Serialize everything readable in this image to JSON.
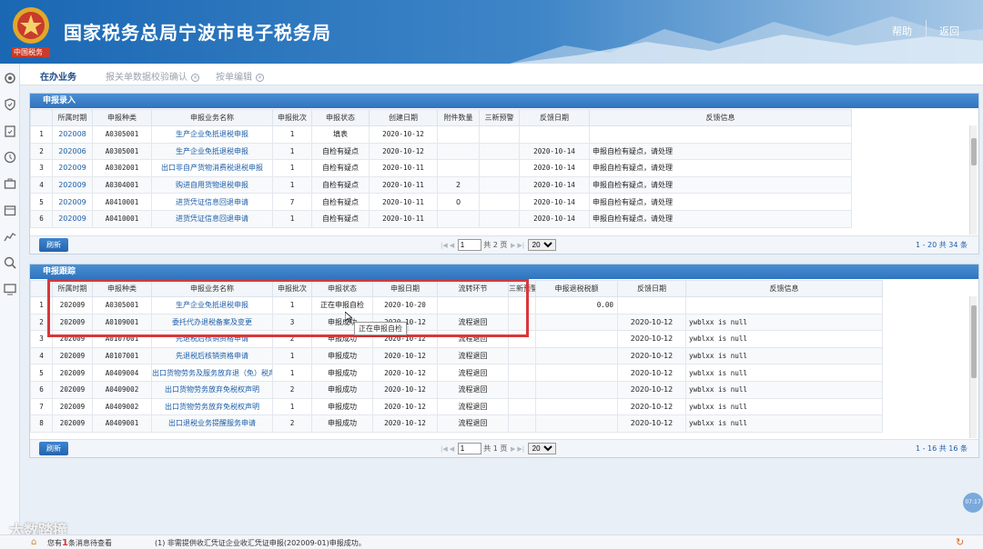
{
  "header": {
    "title": "国家税务总局宁波市电子税务局",
    "emblem_text": "中国税务",
    "help": "帮助",
    "back": "返回"
  },
  "tabs": [
    {
      "label": "在办业务"
    },
    {
      "label": "报关单数据校验确认"
    },
    {
      "label": "按单编辑"
    }
  ],
  "sidebar_icons": [
    "gear-icon",
    "shield-icon",
    "clipboard-check-icon",
    "tag-icon",
    "briefcase-icon",
    "calendar-icon",
    "chart-icon",
    "search-icon",
    "monitor-icon"
  ],
  "entry": {
    "title": "申报录入",
    "headers": [
      "",
      "所属时期",
      "申报种类",
      "申报业务名称",
      "申报批次",
      "申报状态",
      "创建日期",
      "附件数量",
      "三新预警",
      "反馈日期",
      "反馈信息"
    ],
    "rows": [
      [
        "1",
        "202008",
        "A0305001",
        "生产企业免抵退税申报",
        "1",
        "填表",
        "2020-10-12",
        "",
        "",
        "",
        ""
      ],
      [
        "2",
        "202006",
        "A0305001",
        "生产企业免抵退税申报",
        "1",
        "自检有疑点",
        "2020-10-12",
        "",
        "",
        "2020-10-14",
        "申报自检有疑点，请处理"
      ],
      [
        "3",
        "202009",
        "A0302001",
        "出口非自产货物消费税退税申报",
        "1",
        "自检有疑点",
        "2020-10-11",
        "",
        "",
        "2020-10-14",
        "申报自检有疑点，请处理"
      ],
      [
        "4",
        "202009",
        "A0304001",
        "购进自用货物退税申报",
        "1",
        "自检有疑点",
        "2020-10-11",
        "2",
        "",
        "2020-10-14",
        "申报自检有疑点，请处理"
      ],
      [
        "5",
        "202009",
        "A0410001",
        "进货凭证信息回退申请",
        "7",
        "自检有疑点",
        "2020-10-11",
        "0",
        "",
        "2020-10-14",
        "申报自检有疑点，请处理"
      ],
      [
        "6",
        "202009",
        "A0410001",
        "进货凭证信息回退申请",
        "1",
        "自检有疑点",
        "2020-10-11",
        "",
        "",
        "2020-10-14",
        "申报自检有疑点，请处理"
      ]
    ],
    "refresh": "刷新",
    "page": "1",
    "page_total": "共 2 页",
    "page_size": "20",
    "page_info": "1 - 20  共 34 条"
  },
  "track": {
    "title": "申报跟踪",
    "headers": [
      "",
      "所属时期",
      "申报种类",
      "申报业务名称",
      "申报批次",
      "申报状态",
      "申报日期",
      "流转环节",
      "三新预警",
      "申报退税税额",
      "反馈日期",
      "反馈信息"
    ],
    "rows": [
      [
        "1",
        "202009",
        "A0305001",
        "生产企业免抵退税申报",
        "1",
        "正在申报自检",
        "2020-10-20",
        "",
        "",
        "0.00",
        "",
        ""
      ],
      [
        "2",
        "202009",
        "A0109001",
        "委托代办退税备案及变更",
        "3",
        "申报成功",
        "2020-10-12",
        "流程退回",
        "",
        "",
        "2020-10-12",
        "ywblxx is null"
      ],
      [
        "3",
        "202009",
        "A0107001",
        "先退税后核销资格申请",
        "2",
        "申报成功",
        "2020-10-12",
        "流程退回",
        "",
        "",
        "2020-10-12",
        "ywblxx is null"
      ],
      [
        "4",
        "202009",
        "A0107001",
        "先退税后核销资格申请",
        "1",
        "申报成功",
        "2020-10-12",
        "流程退回",
        "",
        "",
        "2020-10-12",
        "ywblxx is null"
      ],
      [
        "5",
        "202009",
        "A0409004",
        "出口货物劳务及服务放弃退（免）税声明",
        "1",
        "申报成功",
        "2020-10-12",
        "流程退回",
        "",
        "",
        "2020-10-12",
        "ywblxx is null"
      ],
      [
        "6",
        "202009",
        "A0409002",
        "出口货物劳务放弃免税权声明",
        "2",
        "申报成功",
        "2020-10-12",
        "流程退回",
        "",
        "",
        "2020-10-12",
        "ywblxx is null"
      ],
      [
        "7",
        "202009",
        "A0409002",
        "出口货物劳务放弃免税权声明",
        "1",
        "申报成功",
        "2020-10-12",
        "流程退回",
        "",
        "",
        "2020-10-12",
        "ywblxx is null"
      ],
      [
        "8",
        "202009",
        "A0409001",
        "出口退税业务提醒服务申请",
        "2",
        "申报成功",
        "2020-10-12",
        "流程退回",
        "",
        "",
        "2020-10-12",
        "ywblxx is null"
      ]
    ],
    "refresh": "刷新",
    "page": "1",
    "page_total": "共 1 页",
    "page_size": "20",
    "page_info": "1 - 16  共 16 条"
  },
  "tooltip": "正在申报自检",
  "status": {
    "msg_prefix": "您有",
    "msg_count": "1",
    "msg_suffix": "条消息待查看",
    "notice": "(1)  非需提供收汇凭证企业收汇凭证申报(202009-01)申报成功。"
  },
  "chat_badge": "07:17",
  "watermark": "大数踏撞"
}
